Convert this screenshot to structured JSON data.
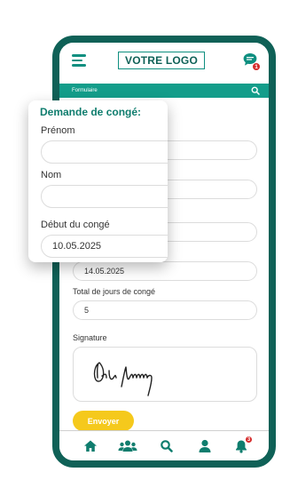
{
  "header": {
    "logo_text": "VOTRE LOGO",
    "chat_badge": "1"
  },
  "form_bar": {
    "title": "Formulaire"
  },
  "form": {
    "fields": [
      {
        "label": "",
        "value": ""
      },
      {
        "label": "",
        "value": ""
      },
      {
        "label": "",
        "value": ""
      },
      {
        "label": "",
        "value": "14.05.2025"
      },
      {
        "label": "Total de jours de congé",
        "value": "5"
      }
    ],
    "signature_label": "Signature",
    "submit_label": "Envoyer"
  },
  "card": {
    "title": "Demande de congé:",
    "fields": [
      {
        "label": "Prénom",
        "value": ""
      },
      {
        "label": "Nom",
        "value": ""
      },
      {
        "label": "Début du congé",
        "value": "10.05.2025"
      }
    ]
  },
  "bottom_nav": {
    "items": [
      "home-icon",
      "users-icon",
      "search-icon",
      "user-icon",
      "bell-icon"
    ],
    "bell_badge": "3"
  },
  "colors": {
    "frame": "#0f6157",
    "accent": "#139d8a",
    "button": "#f5c91c",
    "badge": "#d52a2a"
  }
}
